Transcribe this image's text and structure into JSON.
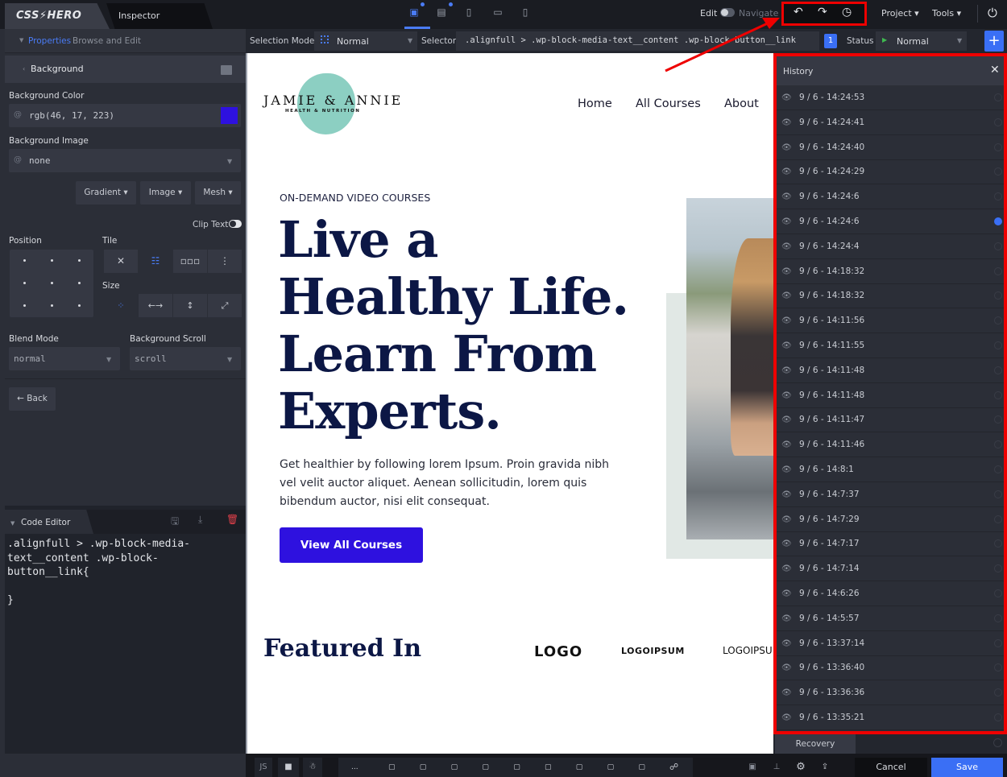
{
  "app": {
    "brand": "CSS⚡HERO",
    "inspector_tab": "Inspector"
  },
  "topbar": {
    "devices": [
      {
        "name": "desktop",
        "icon": "▣",
        "active": true
      },
      {
        "name": "laptop",
        "icon": "▤",
        "active": false
      },
      {
        "name": "tablet",
        "icon": "▯",
        "active": false
      },
      {
        "name": "tablet-landscape",
        "icon": "▭",
        "active": false
      },
      {
        "name": "mobile",
        "icon": "▯",
        "active": false
      }
    ],
    "edit_label": "Edit",
    "navigate_label": "Navigate",
    "undo_icon": "↶",
    "redo_icon": "↷",
    "history_icon": "◷",
    "project_menu": "Project ▾",
    "tools_menu": "Tools ▾",
    "power_icon": "⏻"
  },
  "toolbar": {
    "selection_mode_label": "Selection Mode",
    "selection_mode_value": "Normal",
    "selector_label": "Selector",
    "selector_value": ".alignfull > .wp-block-media-text__content .wp-block-button__link",
    "match_count": "1",
    "status_label": "Status",
    "status_value": "Normal",
    "add_label": "+"
  },
  "left_panel": {
    "properties_label": "Properties",
    "properties_sub": "Browse and Edit",
    "section_title": "Background",
    "background_color_label": "Background Color",
    "background_color_value": "rgb(46, 17, 223)",
    "swatch_color": "#2e11df",
    "background_image_label": "Background Image",
    "background_image_value": "none",
    "buttons": [
      "Gradient ▾",
      "Image ▾",
      "Mesh ▾"
    ],
    "clip_text_label": "Clip Text",
    "position_label": "Position",
    "tile_label": "Tile",
    "tile_options": [
      "✕",
      "☷",
      "▫▫▫",
      "⋮"
    ],
    "size_label": "Size",
    "size_options": [
      "⁘",
      "←→",
      "↕",
      "⤢"
    ],
    "blend_mode_label": "Blend Mode",
    "blend_mode_value": "normal",
    "background_scroll_label": "Background Scroll",
    "background_scroll_value": "scroll",
    "back_label": "← Back"
  },
  "code_editor": {
    "title": "Code Editor",
    "code": ".alignfull > .wp-block-media-\ntext__content .wp-block-\nbutton__link{\n\n}"
  },
  "site": {
    "logo_title": "JAMIE & ANNIE",
    "logo_subtitle": "HEALTH & NUTRITION",
    "nav": [
      "Home",
      "All Courses",
      "About"
    ],
    "eyebrow": "ON-DEMAND VIDEO COURSES",
    "hero": "Live a\nHealthy Life.\nLearn From\nExperts.",
    "description": "Get healthier by following lorem Ipsum. Proin gravida nibh vel velit auctor aliquet. Aenean sollicitudin, lorem quis bibendum auctor, nisi elit consequat.",
    "cta": "View All Courses",
    "featured_title": "Featured In",
    "featured_logos": [
      "LOGO",
      "LOGOIPSUM",
      "LOGOIPSU"
    ]
  },
  "history": {
    "title": "History",
    "close_icon": "✕",
    "entries": [
      {
        "label": "9 / 6 - 14:24:53",
        "selected": false
      },
      {
        "label": "9 / 6 - 14:24:41",
        "selected": false
      },
      {
        "label": "9 / 6 - 14:24:40",
        "selected": false
      },
      {
        "label": "9 / 6 - 14:24:29",
        "selected": false
      },
      {
        "label": "9 / 6 - 14:24:6",
        "selected": false
      },
      {
        "label": "9 / 6 - 14:24:6",
        "selected": true
      },
      {
        "label": "9 / 6 - 14:24:4",
        "selected": false
      },
      {
        "label": "9 / 6 - 14:18:32",
        "selected": false
      },
      {
        "label": "9 / 6 - 14:18:32",
        "selected": false
      },
      {
        "label": "9 / 6 - 14:11:56",
        "selected": false
      },
      {
        "label": "9 / 6 - 14:11:55",
        "selected": false
      },
      {
        "label": "9 / 6 - 14:11:48",
        "selected": false
      },
      {
        "label": "9 / 6 - 14:11:48",
        "selected": false
      },
      {
        "label": "9 / 6 - 14:11:47",
        "selected": false
      },
      {
        "label": "9 / 6 - 14:11:46",
        "selected": false
      },
      {
        "label": "9 / 6 - 14:8:1",
        "selected": false
      },
      {
        "label": "9 / 6 - 14:7:37",
        "selected": false
      },
      {
        "label": "9 / 6 - 14:7:29",
        "selected": false
      },
      {
        "label": "9 / 6 - 14:7:17",
        "selected": false
      },
      {
        "label": "9 / 6 - 14:7:14",
        "selected": false
      },
      {
        "label": "9 / 6 - 14:6:26",
        "selected": false
      },
      {
        "label": "9 / 6 - 14:5:57",
        "selected": false
      },
      {
        "label": "9 / 6 - 13:37:14",
        "selected": false
      },
      {
        "label": "9 / 6 - 13:36:40",
        "selected": false
      },
      {
        "label": "9 / 6 - 13:36:36",
        "selected": false
      },
      {
        "label": "9 / 6 - 13:35:21",
        "selected": false
      }
    ],
    "recovery_label": "Recovery"
  },
  "bottombar": {
    "js_label": "JS",
    "video_icon": "■",
    "bug_icon": "☃",
    "crumb_more": "...",
    "crumb_count": 9,
    "link_icon": "☍",
    "cancel_label": "Cancel",
    "save_label": "Save"
  },
  "colors": {
    "accent": "#3a6ff5",
    "highlight": "#e00000",
    "cta": "#2e11df"
  }
}
